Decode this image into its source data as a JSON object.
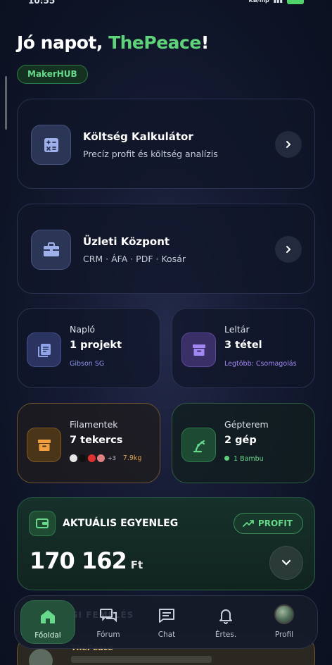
{
  "greeting": {
    "prefix": "Jó napot, ",
    "name": "ThePeace",
    "suffix": "!"
  },
  "badge": "MakerHUB",
  "wide_cards": [
    {
      "title": "Költség Kalkulátor",
      "subtitle": "Precíz profit és költség analízis",
      "icon": "calculator-icon"
    },
    {
      "title": "Üzleti Központ",
      "subtitle": "CRM · ÁFA · PDF · Kosár",
      "icon": "briefcase-icon"
    }
  ],
  "small_cards": {
    "naplo": {
      "label": "Napló",
      "value": "1 projekt",
      "meta": "Gibson SG",
      "icon": "journal-icon"
    },
    "leltar": {
      "label": "Leltár",
      "value": "3 tétel",
      "meta": "Legtöbb: Csomagolás",
      "icon": "archive-icon"
    },
    "filamentek": {
      "label": "Filamentek",
      "value": "7 tekercs",
      "more": "+3",
      "weight": "7.9kg",
      "icon": "archive-icon",
      "colors": [
        "#e6e6e6",
        "#111111",
        "#e03030",
        "#e08080"
      ]
    },
    "gepterem": {
      "label": "Gépterem",
      "value": "2 gép",
      "meta": "1 Bambu",
      "icon": "robot-arm-icon"
    }
  },
  "balance": {
    "title": "AKTUÁLIS EGYENLEG",
    "profit_label": "PROFIT",
    "amount": "170 162",
    "currency": "Ft"
  },
  "peek": {
    "name": "ThePeace"
  },
  "nav": {
    "faded": "KÖZÖSSÉGI FEMELÉS",
    "items": [
      {
        "label": "Főoldal",
        "icon": "home-icon"
      },
      {
        "label": "Fórum",
        "icon": "forum-icon"
      },
      {
        "label": "Chat",
        "icon": "chat-icon"
      },
      {
        "label": "Értes.",
        "icon": "bell-icon"
      },
      {
        "label": "Profil",
        "icon": "avatar-icon"
      }
    ]
  },
  "colors": {
    "accent_green": "#5ed37a",
    "purple": "#8b6ff0",
    "blue": "#8fa4e8",
    "orange": "#f0a040"
  }
}
